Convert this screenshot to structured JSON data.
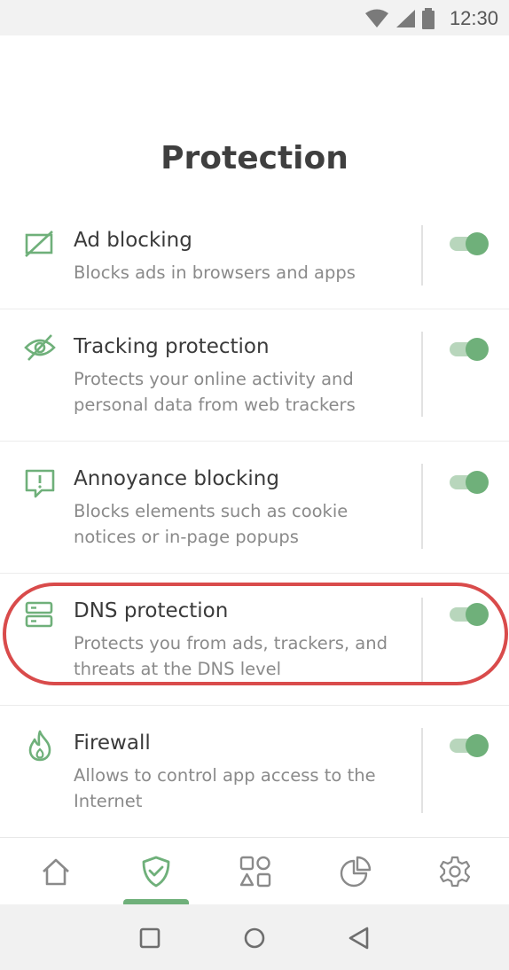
{
  "status_bar": {
    "time": "12:30",
    "icons": [
      "wifi-icon",
      "signal-icon",
      "battery-icon"
    ]
  },
  "page": {
    "title": "Protection"
  },
  "items": [
    {
      "icon": "ad-blocking-icon",
      "title": "Ad blocking",
      "description": "Blocks ads in browsers and apps",
      "enabled": true
    },
    {
      "icon": "eye-crossed-icon",
      "title": "Tracking protection",
      "description": "Protects your online activity and personal data from web trackers",
      "enabled": true
    },
    {
      "icon": "exclamation-bubble-icon",
      "title": "Annoyance blocking",
      "description": "Blocks elements such as cookie notices or in-page popups",
      "enabled": true
    },
    {
      "icon": "server-icon",
      "title": "DNS protection",
      "description": "Protects you from ads, trackers, and threats at the DNS level",
      "enabled": true,
      "highlighted": true
    },
    {
      "icon": "flame-icon",
      "title": "Firewall",
      "description": "Allows to control app access to the Internet",
      "enabled": true
    }
  ],
  "bottom_nav": {
    "items": [
      "home-icon",
      "shield-check-icon",
      "apps-icon",
      "stats-icon",
      "settings-icon"
    ],
    "active": "shield-check-icon"
  },
  "system_nav": [
    "recents-square-icon",
    "home-circle-icon",
    "back-triangle-icon"
  ],
  "colors": {
    "accent": "#6fb07a",
    "highlight": "#d94b4b",
    "toggle_track": "#b8d6bc"
  }
}
